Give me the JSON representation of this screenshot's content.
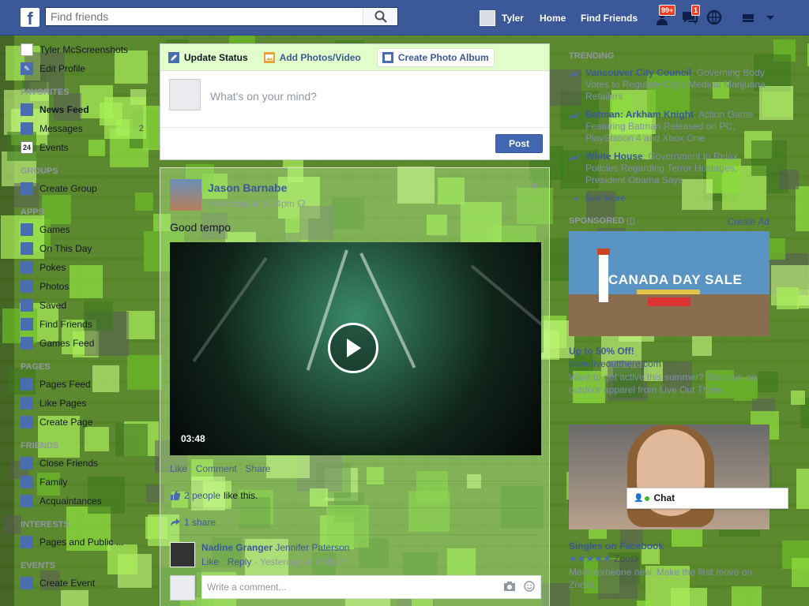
{
  "topbar": {
    "logo": "f",
    "search_placeholder": "Find friends",
    "user_name": "Tyler",
    "home": "Home",
    "find_friends": "Find Friends",
    "friend_requests_badge": "99+",
    "messages_badge": "1",
    "accent": "#3b5998"
  },
  "sidebar": {
    "profile_name": "Tyler McScreenshots",
    "edit_profile": "Edit Profile",
    "favorites_head": "FAVORITES",
    "favorites": [
      {
        "label": "News Feed",
        "icon": "news-feed-icon"
      },
      {
        "label": "Messages",
        "count": "2",
        "icon": "messages-icon"
      },
      {
        "label": "Events",
        "icon": "calendar-icon",
        "icon_text": "24"
      }
    ],
    "groups_head": "GROUPS",
    "groups": [
      {
        "label": "Create Group",
        "icon": "create-group-icon"
      }
    ],
    "apps_head": "APPS",
    "apps": [
      {
        "label": "Games",
        "icon": "games-icon"
      },
      {
        "label": "On This Day",
        "icon": "on-this-day-icon"
      },
      {
        "label": "Pokes",
        "icon": "pokes-icon"
      },
      {
        "label": "Photos",
        "icon": "photos-icon"
      },
      {
        "label": "Saved",
        "icon": "saved-icon"
      },
      {
        "label": "Find Friends",
        "icon": "find-friends-icon"
      },
      {
        "label": "Games Feed",
        "icon": "games-feed-icon"
      }
    ],
    "pages_head": "PAGES",
    "pages": [
      {
        "label": "Pages Feed",
        "icon": "pages-feed-icon"
      },
      {
        "label": "Like Pages",
        "icon": "like-pages-icon"
      },
      {
        "label": "Create Page",
        "icon": "create-page-icon"
      }
    ],
    "friends_head": "FRIENDS",
    "friends": [
      {
        "label": "Close Friends",
        "icon": "close-friends-icon"
      },
      {
        "label": "Family",
        "icon": "family-icon"
      },
      {
        "label": "Acquaintances",
        "icon": "acquaintances-icon"
      }
    ],
    "interests_head": "INTERESTS",
    "interests": [
      {
        "label": "Pages and Public ...",
        "icon": "interests-icon"
      }
    ],
    "events_head": "EVENTS",
    "events": [
      {
        "label": "Create Event",
        "icon": "create-event-icon"
      }
    ]
  },
  "composer": {
    "tab_status": "Update Status",
    "tab_photos": "Add Photos/Video",
    "tab_album": "Create Photo Album",
    "placeholder": "What's on your mind?",
    "post_label": "Post"
  },
  "story": {
    "author": "Jason Barnabe",
    "time": "Yesterday at 9:34pm",
    "text": "Good tempo",
    "video_duration": "03:48",
    "like": "Like",
    "comment": "Comment",
    "share": "Share",
    "sep": "·",
    "likes_link": "2 people",
    "likes_suffix": "like this.",
    "shares": "1 share",
    "comment_author": "Nadine Granger",
    "comment_text": "Jennifer Paterson",
    "comment_like": "Like",
    "comment_reply": "Reply",
    "comment_time": "Yesterday at 9:35pm",
    "write_placeholder": "Write a comment..."
  },
  "rightcol": {
    "trending_head": "TRENDING",
    "trending": [
      {
        "topic": "Vancouver City Council",
        "desc": ": Governing Body Votes to Regulate City's Medical Marijuana Retailers"
      },
      {
        "topic": "Batman: Arkham Knight",
        "desc": ": Action Game Featuring Batman Released on PC, PlayStation 4 and Xbox One"
      },
      {
        "topic": "White House",
        "desc": ": Government to Relax Policies Regarding Terror Hostages, President Obama Says"
      }
    ],
    "see_more": "See More",
    "sponsored_head": "SPONSORED",
    "create_ad": "Create Ad",
    "ad1_banner": "CANADA DAY SALE",
    "ad1_title": "Up to 50% Off!",
    "ad1_domain": "www.liveoutthere.com",
    "ad1_desc": "Want to get active this summer? Stock up on outdoor apparel from Live Out There!",
    "ad2_title": "Singles on Facebook",
    "ad2_rating": "3.5",
    "ad2_stars": "★★★★★",
    "ad2_brand": "Zoosk",
    "ad2_desc": "Meet someone new. Make the first move on Zoosk."
  },
  "chat": {
    "label": "Chat"
  }
}
